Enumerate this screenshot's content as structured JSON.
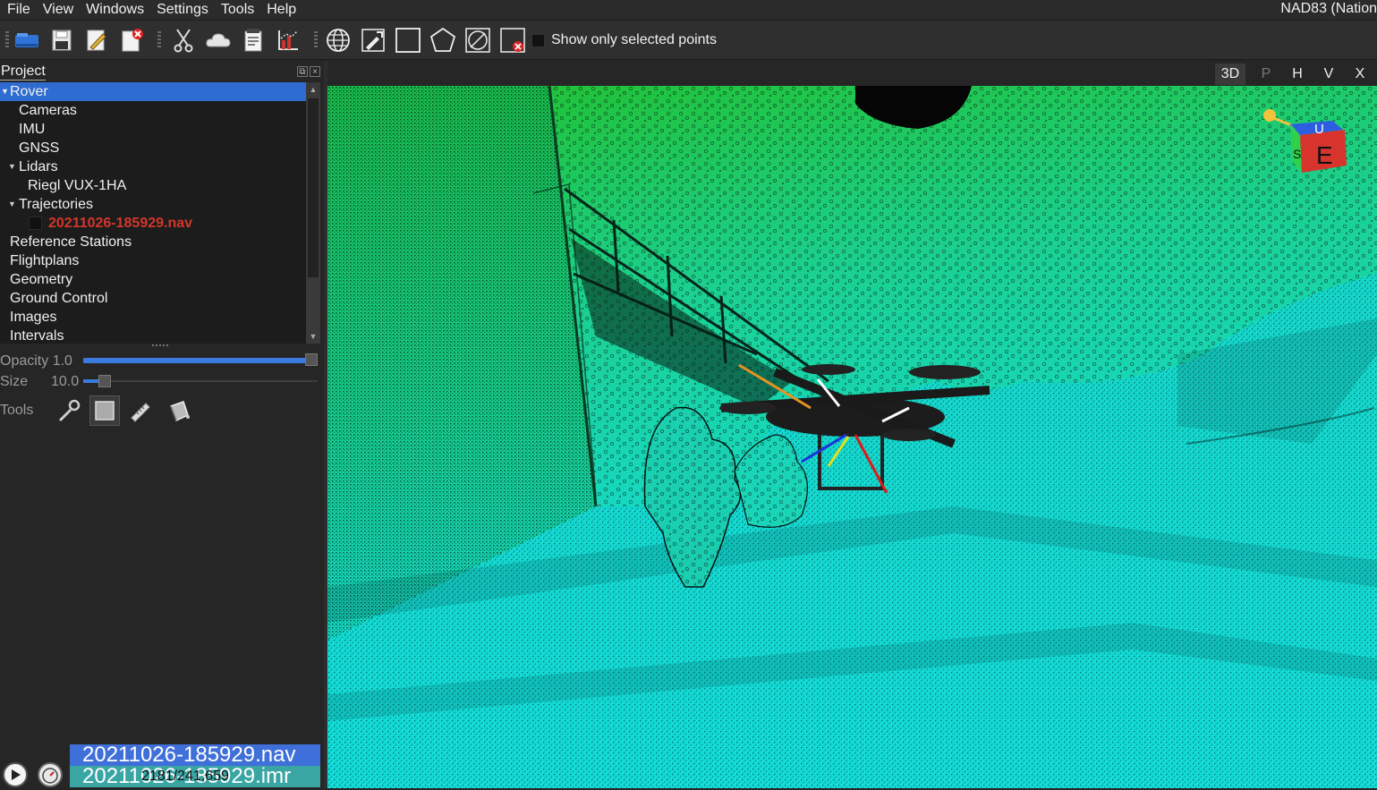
{
  "menubar": {
    "items": [
      "File",
      "View",
      "Windows",
      "Settings",
      "Tools",
      "Help"
    ],
    "crs_label": "NAD83 (Nation"
  },
  "toolbar": {
    "show_selected_label": "Show only selected points"
  },
  "project": {
    "title": "Project",
    "tree": {
      "rover": "Rover",
      "cameras": "Cameras",
      "imu": "IMU",
      "gnss": "GNSS",
      "lidars": "Lidars",
      "lidar_model": "Riegl VUX-1HA",
      "trajectories": "Trajectories",
      "traj_file": "20211026-185929.nav",
      "reference_stations": "Reference Stations",
      "flightplans": "Flightplans",
      "geometry": "Geometry",
      "ground_control": "Ground Control",
      "images": "Images",
      "intervals": "Intervals"
    },
    "opacity_label": "Opacity",
    "opacity_value": "1.0",
    "size_label": "Size",
    "size_value": "10.0",
    "tools_label": "Tools"
  },
  "files": {
    "nav": "20211026-185929.nav",
    "imr": "20211026-185929.imr",
    "counter": "2181/241,659"
  },
  "view_tabs": [
    "3D",
    "P",
    "H",
    "V",
    "X"
  ],
  "nav_cube": {
    "face_front": "E",
    "face_side": "S",
    "face_top": "U"
  },
  "colors": {
    "selection": "#2f6cd1",
    "traj_file": "#d3372a",
    "point_green": "#22c04a",
    "point_cyan": "#16d9d2"
  }
}
